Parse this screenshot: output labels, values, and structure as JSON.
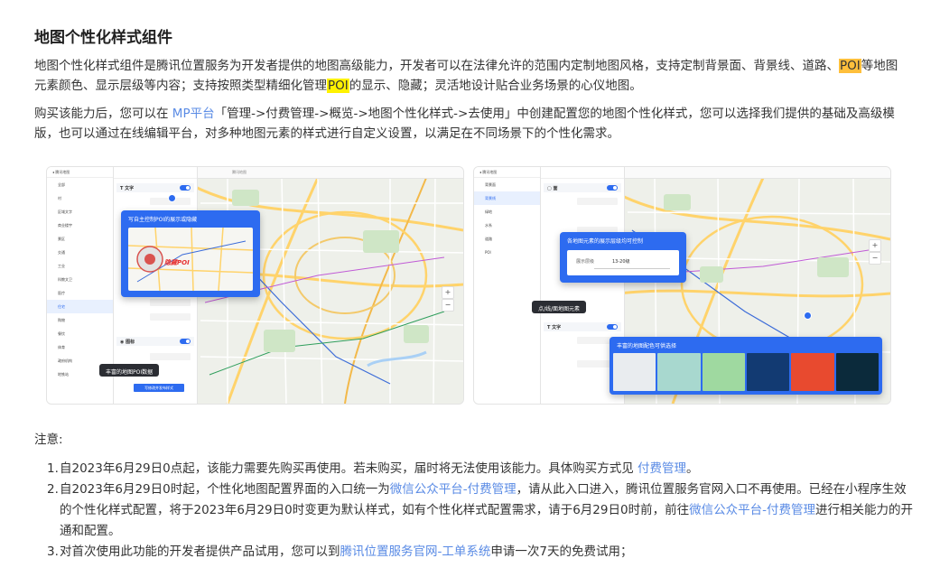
{
  "title": "地图个性化样式组件",
  "intro": {
    "part1": "地图个性化样式组件是腾讯位置服务为开发者提供的地图高级能力，开发者可以在法律允许的范围内定制地图风格，支持定制背景面、背景线、道路、",
    "poi1": "POI",
    "part2": "等地图元素颜色、显示层级等内容；支持按照类型精细化管理",
    "poi2": "POI",
    "part3": "的显示、隐藏；灵活地设计贴合业务场景的心仪地图。"
  },
  "purchase": {
    "part1": "购买该能力后，您可以在 ",
    "link": "MP平台",
    "part2": "「管理->付费管理->概览->地图个性化样式->去使用」中创建配置您的地图个性化样式，您可以选择我们提供的基础及高级模版，也可以通过在线编辑平台，对多种地图元素的样式进行自定义设置，以满足在不同场景下的个性化需求。"
  },
  "screenshot1": {
    "callout_hide": "写自主控制POI的展示或隐藏",
    "callout_data": "丰富的地图POI数据",
    "hidden_poi": "隐藏POI",
    "toolbar_label": "腾讯地图",
    "sidebar_items": [
      "全部",
      "村",
      "区域文字",
      "商业楼宇",
      "景区",
      "交通",
      "工业",
      "科教文卫",
      "医疗",
      "住宅",
      "购物",
      "餐饮",
      "体育",
      "政府机构",
      "地铁站",
      "道路",
      "水系",
      "绿地"
    ],
    "zoom_in": "+",
    "zoom_out": "−",
    "apply_button": "写修改并发布样式"
  },
  "screenshot2": {
    "callout_level": "各地图元素的展示层级均可控制",
    "level_label": "展示层级",
    "level_range": "13-20级",
    "callout_elements": "点/线/面地图元素",
    "callout_templates": "丰富的地图配色可供选择",
    "template_colors": [
      "#e9ecef",
      "#a8d8cf",
      "#9fd9a0",
      "#123a72",
      "#e84a2f",
      "#0b2a3b"
    ],
    "sidebar_items": [
      "背景面",
      "背景线",
      "绿地",
      "水系",
      "道路",
      "POI"
    ],
    "zoom_in": "+",
    "zoom_out": "−"
  },
  "notes_heading": "注意:",
  "notes": [
    {
      "num": "1.",
      "pre": "自2023年6月29日0点起，该能力需要先购买再使用。若未购买，届时将无法使用该能力。具体购买方式见 ",
      "link": "付费管理",
      "post": "。"
    },
    {
      "num": "2.",
      "pre": "自2023年6月29日0时起，个性化地图配置界面的入口统一为",
      "link": "微信公众平台-付费管理",
      "mid": "，请从此入口进入，腾讯位置服务官网入口不再使用。已经在小程序生效的个性化样式配置，将于2023年6月29日0时变更为默认样式，如有个性化样式配置需求，请于6月29日0时前，前往",
      "link2": "微信公众平台-付费管理",
      "post": "进行相关能力的开通和配置。"
    },
    {
      "num": "3.",
      "pre": "对首次使用此功能的开发者提供产品试用，您可以到",
      "link": "腾讯位置服务官网-工单系统",
      "post": "申请一次7天的免费试用；"
    }
  ]
}
